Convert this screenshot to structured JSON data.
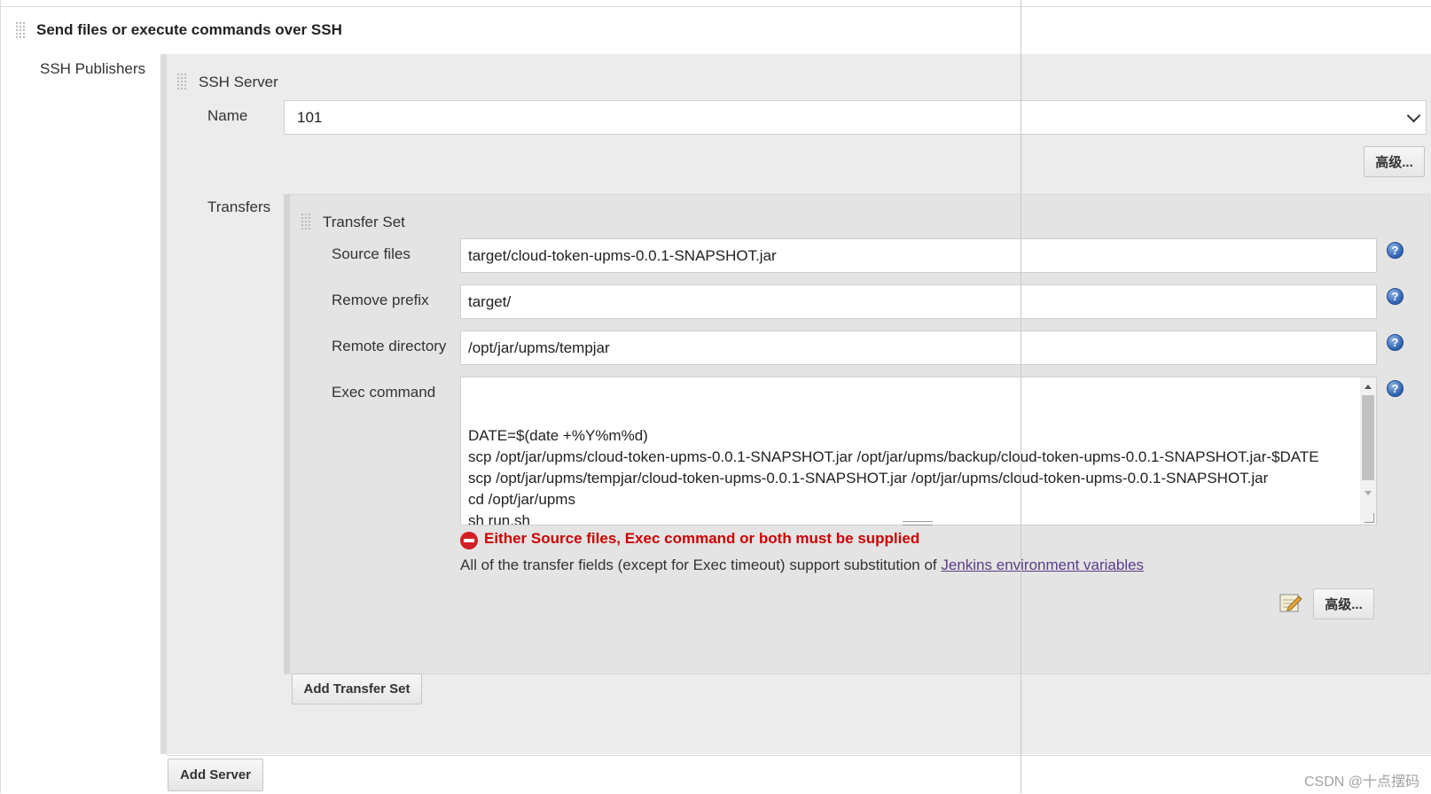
{
  "section": {
    "title": "Send files or execute commands over SSH",
    "publishers_label": "SSH Publishers"
  },
  "ssh_server": {
    "title": "SSH Server",
    "name_label": "Name",
    "name_value": "101",
    "advanced_label": "高级..."
  },
  "transfers": {
    "label": "Transfers",
    "set_title": "Transfer Set",
    "fields": {
      "source_files_label": "Source files",
      "source_files_value": "target/cloud-token-upms-0.0.1-SNAPSHOT.jar",
      "remove_prefix_label": "Remove prefix",
      "remove_prefix_value": "target/",
      "remote_directory_label": "Remote directory",
      "remote_directory_value": "/opt/jar/upms/tempjar",
      "exec_command_label": "Exec command",
      "exec_command_value": "DATE=$(date +%Y%m%d)\nscp /opt/jar/upms/cloud-token-upms-0.0.1-SNAPSHOT.jar /opt/jar/upms/backup/cloud-token-upms-0.0.1-SNAPSHOT.jar-$DATE\nscp /opt/jar/upms/tempjar/cloud-token-upms-0.0.1-SNAPSHOT.jar /opt/jar/upms/cloud-token-upms-0.0.1-SNAPSHOT.jar\ncd /opt/jar/upms\nsh run.sh"
    },
    "error_message": "Either Source files, Exec command or both must be supplied",
    "info_prefix": "All of the transfer fields (except for Exec timeout) support substitution of ",
    "info_link": "Jenkins environment variables",
    "advanced_label": "高级...",
    "add_transfer_set_label": "Add Transfer Set"
  },
  "add_server_label": "Add Server",
  "help_glyph": "?",
  "watermark": "CSDN @十点摆码",
  "icons": {
    "drag_handle": "drag-handle-icon",
    "help": "help-icon",
    "error": "error-icon",
    "notepad": "notepad-icon",
    "chevron": "chevron-down-icon"
  },
  "colors": {
    "error": "#cc0000",
    "link": "#5a3c87",
    "help_blue": "#2c5fae",
    "panel_bg": "#ececec"
  }
}
